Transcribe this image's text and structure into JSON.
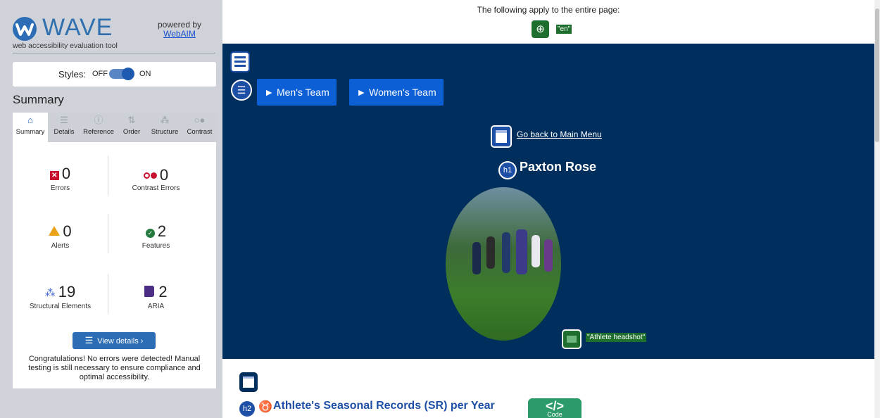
{
  "brand": {
    "name": "WAVE",
    "tagline": "web accessibility evaluation tool",
    "powered_by": "powered by",
    "webaim_link": "WebAIM"
  },
  "styles_toggle": {
    "label": "Styles:",
    "off": "OFF",
    "on": "ON",
    "state": "on"
  },
  "summary_heading": "Summary",
  "tabs": [
    {
      "label": "Summary",
      "icon": "home-icon",
      "active": true
    },
    {
      "label": "Details",
      "icon": "list-icon",
      "active": false
    },
    {
      "label": "Reference",
      "icon": "info-icon",
      "active": false
    },
    {
      "label": "Order",
      "icon": "order-icon",
      "active": false
    },
    {
      "label": "Structure",
      "icon": "structure-icon",
      "active": false
    },
    {
      "label": "Contrast",
      "icon": "contrast-icon",
      "active": false
    }
  ],
  "stats": {
    "errors": {
      "count": "0",
      "label": "Errors",
      "color": "#c8102e"
    },
    "contrast_errors": {
      "count": "0",
      "label": "Contrast Errors",
      "color": "#c8102e"
    },
    "alerts": {
      "count": "0",
      "label": "Alerts",
      "color": "#e8a317"
    },
    "features": {
      "count": "2",
      "label": "Features",
      "color": "#257a3e"
    },
    "structural": {
      "count": "19",
      "label": "Structural Elements",
      "color": "#3a5fcd"
    },
    "aria": {
      "count": "2",
      "label": "ARIA",
      "color": "#4b2e83"
    }
  },
  "view_details": "View details ›",
  "congrats": "Congratulations! No errors were detected! Manual testing is still necessary to ensure compliance and optimal accessibility.",
  "page": {
    "apply_text": "The following apply to the entire page:",
    "lang_tag": "\"en\"",
    "buttons": {
      "mens": "► Men's Team",
      "womens": "► Women's Team"
    },
    "back_link": "Go back to Main Menu",
    "h1_badge": "h1",
    "athlete_name": "Paxton Rose",
    "alt_tag": "\"Athlete headshot\"",
    "h2_badge": "h2",
    "h2_text": "Athlete's Seasonal Records (SR) per Year",
    "code_symbol": "</>",
    "code_label": "Code"
  }
}
